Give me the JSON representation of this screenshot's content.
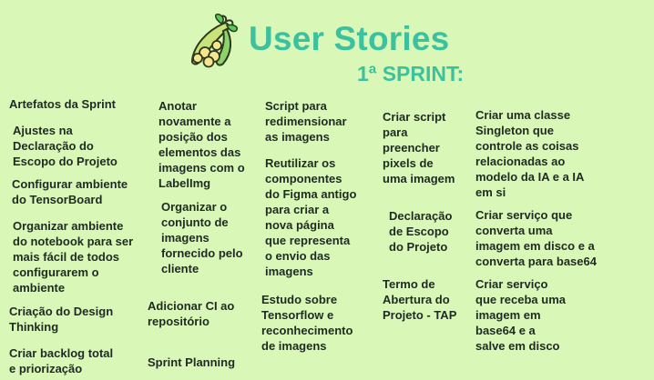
{
  "header": {
    "title": "User Stories",
    "subtitle": "1ª SPRINT:",
    "logo_icon": "pea-pod-icon"
  },
  "colors": {
    "background": "#d9f8b8",
    "title": "#3cc19f",
    "text": "#1f2a22"
  },
  "columns": {
    "col1": [
      "Artefatos da Sprint",
      "Ajustes na\nDeclaração do\nEscopo do Projeto",
      "Configurar ambiente\ndo TensorBoard",
      "Organizar ambiente\ndo notebook para ser\nmais fácil de todos\nconfigurarem o\nambiente",
      "Criação do Design\nThinking",
      "Criar backlog total\ne priorização"
    ],
    "col2": [
      "Anotar\nnovamente a\nposição dos\nelementos das\nimagens com o\nLabelImg",
      "Organizar o\nconjunto de\nimagens\nfornecido pelo\ncliente",
      "Adicionar CI ao\nrepositório",
      "Sprint Planning"
    ],
    "col3": [
      "Script para\nredimensionar\nas imagens",
      "Reutilizar os\ncomponentes\ndo Figma antigo\npara criar a\nnova página\nque representa\no envio das\nimagens",
      "Estudo sobre\nTensorflow e\nreconhecimento\nde imagens"
    ],
    "col4": [
      "Criar script\npara\npreencher\npixels de\numa imagem",
      "Declaração\nde Escopo\ndo Projeto",
      "Termo de\nAbertura do\nProjeto - TAP"
    ],
    "col5": [
      "Criar uma classe\nSingleton que\ncontrole as coisas\nrelacionadas ao\nmodelo da IA e a IA\nem si",
      "Criar serviço que\nconverta uma\nimagem em disco e a\nconverta para base64",
      "Criar serviço\nque receba uma\nimagem em\nbase64 e a\nsalve em disco"
    ]
  }
}
